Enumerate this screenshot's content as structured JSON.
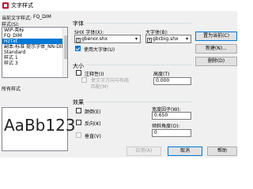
{
  "window": {
    "title": "文字样式"
  },
  "current_style": {
    "label": "当前文字样式:",
    "value": "FQ_DIM"
  },
  "styles": {
    "label": "样式(S):",
    "items": [
      {
        "label": "WIP-英标"
      },
      {
        "label": "FQ_DIM"
      },
      {
        "label": "HzTxt",
        "selected": true
      },
      {
        "label": "副本-标准 提示字体_NN-DIM"
      },
      {
        "label": "Standard"
      },
      {
        "label": "样式 1"
      },
      {
        "label": "样式 3"
      }
    ],
    "filter_label": "所有样式"
  },
  "preview": {
    "text": "AaBb123"
  },
  "font": {
    "group_label": "字体",
    "shx_label": "SHX 字体(X):",
    "shx_value": "gbenor.shx",
    "big_font_label": "大字体(B):",
    "big_font_value": "gbcbig.shx",
    "use_big_font_label": "使用大字体(U)",
    "use_big_font_checked": true
  },
  "size": {
    "group_label": "大小",
    "annotative_label": "注释性(I)",
    "annotative_checked": false,
    "match_orientation_label": "使文字方向与布局",
    "match_orientation_label2": "匹配(M)",
    "height_label": "高度(T)",
    "height_value": "0.000"
  },
  "effects": {
    "group_label": "效果",
    "upside_down_label": "颠倒(E)",
    "backwards_label": "反向(K)",
    "vertical_label": "垂直(V)",
    "width_factor_label": "宽度因子(W):",
    "width_factor_value": "0.650",
    "oblique_label": "倾斜角度(O):",
    "oblique_value": "0"
  },
  "buttons": {
    "set_current": "置为当前(C)",
    "new": "新建(N)...",
    "delete": "删除(D)",
    "apply": "应用(A)",
    "cancel": "取消",
    "help": "帮助"
  }
}
